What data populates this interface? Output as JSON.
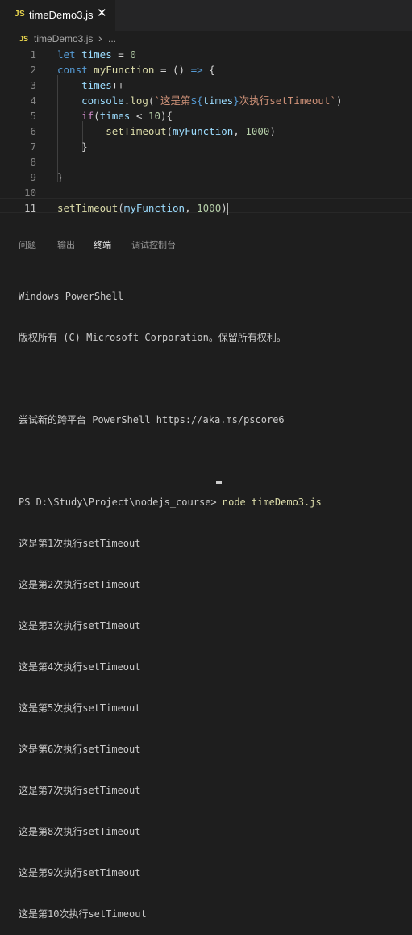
{
  "tab": {
    "badge": "JS",
    "title": "timeDemo3.js",
    "close": "✕"
  },
  "breadcrumb": {
    "badge": "JS",
    "file": "timeDemo3.js",
    "separator": "›",
    "more": "..."
  },
  "editor": {
    "lines": [
      {
        "n": "1",
        "tokens": [
          [
            "kw",
            "let"
          ],
          [
            "op",
            " "
          ],
          [
            "var",
            "times"
          ],
          [
            "op",
            " = "
          ],
          [
            "num",
            "0"
          ]
        ]
      },
      {
        "n": "2",
        "tokens": [
          [
            "kw",
            "const"
          ],
          [
            "op",
            " "
          ],
          [
            "fn",
            "myFunction"
          ],
          [
            "op",
            " = () "
          ],
          [
            "kw",
            "=>"
          ],
          [
            "op",
            " {"
          ]
        ]
      },
      {
        "n": "3",
        "tokens": [
          [
            "op",
            "    "
          ],
          [
            "var",
            "times"
          ],
          [
            "op",
            "++"
          ]
        ]
      },
      {
        "n": "4",
        "tokens": [
          [
            "op",
            "    "
          ],
          [
            "var",
            "console"
          ],
          [
            "op",
            "."
          ],
          [
            "fn",
            "log"
          ],
          [
            "op",
            "("
          ],
          [
            "str",
            "`这是第"
          ],
          [
            "kw",
            "${"
          ],
          [
            "var",
            "times"
          ],
          [
            "kw",
            "}"
          ],
          [
            "str",
            "次执行setTimeout`"
          ],
          [
            "op",
            ")"
          ]
        ]
      },
      {
        "n": "5",
        "tokens": [
          [
            "op",
            "    "
          ],
          [
            "kw2",
            "if"
          ],
          [
            "op",
            "("
          ],
          [
            "var",
            "times"
          ],
          [
            "op",
            " < "
          ],
          [
            "num",
            "10"
          ],
          [
            "op",
            "){"
          ]
        ]
      },
      {
        "n": "6",
        "tokens": [
          [
            "op",
            "        "
          ],
          [
            "fn",
            "setTimeout"
          ],
          [
            "op",
            "("
          ],
          [
            "var",
            "myFunction"
          ],
          [
            "op",
            ", "
          ],
          [
            "num",
            "1000"
          ],
          [
            "op",
            ")"
          ]
        ]
      },
      {
        "n": "7",
        "tokens": [
          [
            "op",
            "    }"
          ]
        ]
      },
      {
        "n": "8",
        "tokens": []
      },
      {
        "n": "9",
        "tokens": [
          [
            "op",
            "}"
          ]
        ]
      },
      {
        "n": "10",
        "tokens": []
      },
      {
        "n": "11",
        "tokens": [
          [
            "fn",
            "setTimeout"
          ],
          [
            "op",
            "("
          ],
          [
            "var",
            "myFunction"
          ],
          [
            "op",
            ", "
          ],
          [
            "num",
            "1000"
          ],
          [
            "op",
            ")"
          ]
        ]
      }
    ]
  },
  "panel": {
    "tabs": [
      "问题",
      "输出",
      "终端",
      "调试控制台"
    ],
    "active_tab": "终端"
  },
  "terminal": {
    "lines": [
      "Windows PowerShell",
      "版权所有 (C) Microsoft Corporation。保留所有权利。",
      "",
      "尝试新的跨平台 PowerShell https://aka.ms/pscore6",
      "",
      "PS D:\\Study\\Project\\nodejs_course> ",
      "这是第1次执行setTimeout",
      "这是第2次执行setTimeout",
      "这是第3次执行setTimeout",
      "这是第4次执行setTimeout",
      "这是第5次执行setTimeout",
      "这是第6次执行setTimeout",
      "这是第7次执行setTimeout",
      "这是第8次执行setTimeout",
      "这是第9次执行setTimeout",
      "这是第10次执行setTimeout"
    ],
    "command": "node timeDemo3.js"
  },
  "colors": {
    "background": "#1e1e1e",
    "keyword": "#569cd6",
    "function": "#dcdcaa",
    "variable": "#9cdcfe",
    "number": "#b5cea8",
    "string": "#ce9178",
    "js_badge": "#e8d44d"
  }
}
